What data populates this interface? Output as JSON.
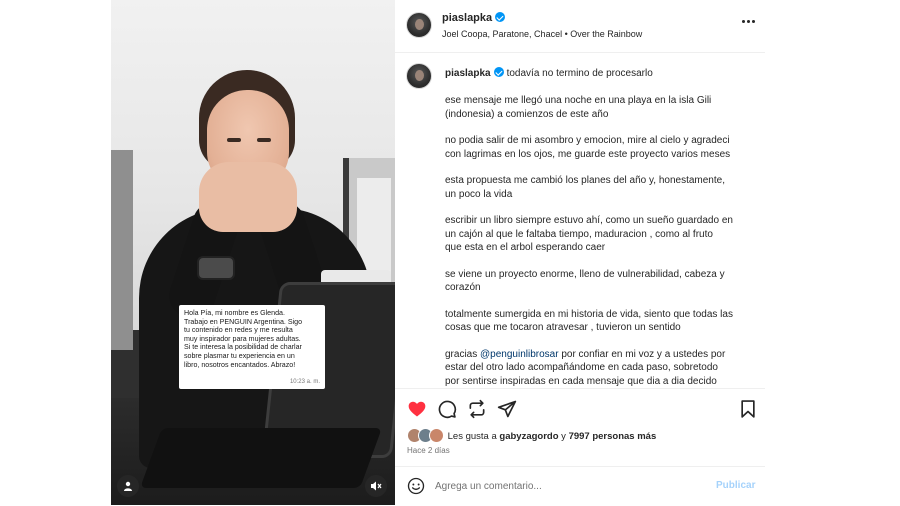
{
  "post": {
    "username": "piaslapka",
    "verified": true,
    "audio": "Joel Coopa, Paratone, Chacel • Over the Rainbow",
    "more_icon": "more-horizontal-icon"
  },
  "media": {
    "message_card": {
      "lines": [
        "Hola Pía, mi nombre es Glenda.",
        "Trabajo en PENGUIN Argentina. Sigo",
        "tu contenido en redes y me resulta",
        "muy inspirador para mujeres adultas.",
        "Si te interesa la posibilidad de charlar",
        "sobre plasmar tu experiencia en un",
        "libro, nosotros encantados. Abrazo!"
      ],
      "time": "10:23 a. m."
    },
    "tag_people_icon": "user-icon",
    "mute_icon": "speaker-muted-icon"
  },
  "caption": {
    "username": "piaslapka",
    "first_line": "todavía no termino de procesarlo",
    "paragraphs": [
      [
        "ese mensaje me llegó una noche en una playa en la isla Gili",
        "(indonesia) a comienzos de este año"
      ],
      [
        "no podia salir de mi asombro y emocion, mire al cielo y agradeci",
        "con lagrimas en los ojos, me guarde este proyecto varios meses"
      ],
      [
        "esta propuesta me cambió los planes del año y, honestamente,",
        "un poco la vida"
      ],
      [
        "escribir un libro siempre estuvo ahí, como un sueño guardado en",
        "un cajón al que le faltaba tiempo, maduracion , como al fruto",
        "que esta en el arbol esperando caer"
      ],
      [
        "se viene un proyecto enorme, lleno de vulnerabilidad, cabeza y",
        "corazón"
      ],
      [
        "totalmente sumergida en mi historia de vida, siento que todas las",
        "cosas que me tocaron atravesar , tuvieron un sentido"
      ]
    ],
    "last_paragraph": {
      "prefix": "gracias ",
      "mention": "@penguinlibrosar",
      "rest_first": " por confiar en mi voz y a ustedes por",
      "lines": [
        "estar del otro lado acompañándome en cada paso, sobretodo",
        "por sentirse inspiradas en cada mensaje que dia a dia decido"
      ]
    }
  },
  "actions": {
    "like_icon": "heart-filled-icon",
    "comment_icon": "comment-icon",
    "share_icon": "repost-icon",
    "send_icon": "send-icon",
    "save_icon": "bookmark-icon",
    "like_color": "#ff3040"
  },
  "likes": {
    "prefix": "Les gusta a ",
    "user": "gabyzagordo",
    "middle": " y ",
    "count": "7997 personas más"
  },
  "time_ago": "Hace 2 días",
  "comment_box": {
    "placeholder": "Agrega un comentario...",
    "value": "",
    "publish_label": "Publicar",
    "emoji_icon": "smiley-icon",
    "publish_color": "#a5d2fb"
  }
}
